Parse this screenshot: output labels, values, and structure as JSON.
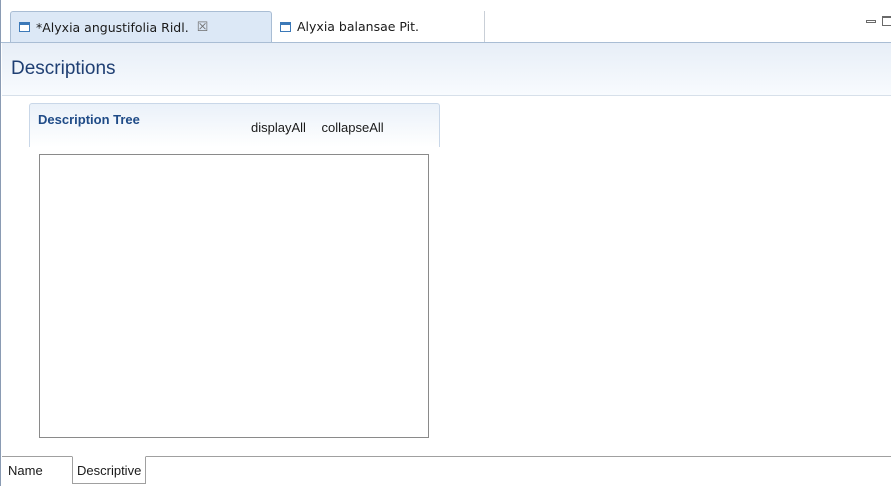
{
  "editor_tabs": [
    {
      "label": "*Alyxia angustifolia Ridl.",
      "icon": "editor-window-icon",
      "active": true,
      "close_icon": "close-icon"
    },
    {
      "label": "Alyxia balansae Pit.",
      "icon": "editor-window-icon",
      "active": false
    }
  ],
  "close_glyph": "☒",
  "view_controls": {
    "minimize_icon": "minimize-icon",
    "maximize_icon": "maximize-icon"
  },
  "form": {
    "title": "Descriptions"
  },
  "section": {
    "title": "Description Tree",
    "actions": {
      "display_all": "displayAll",
      "collapse_all": "collapseAll"
    }
  },
  "page_tabs": [
    {
      "label": "Name",
      "active": false
    },
    {
      "label": "Descriptive",
      "active": true
    }
  ],
  "colors": {
    "title_text": "#1f3f73",
    "section_title": "#1f4b87",
    "active_tab_bg": "#dce8f6",
    "icon_blue": "#3c79b8"
  }
}
